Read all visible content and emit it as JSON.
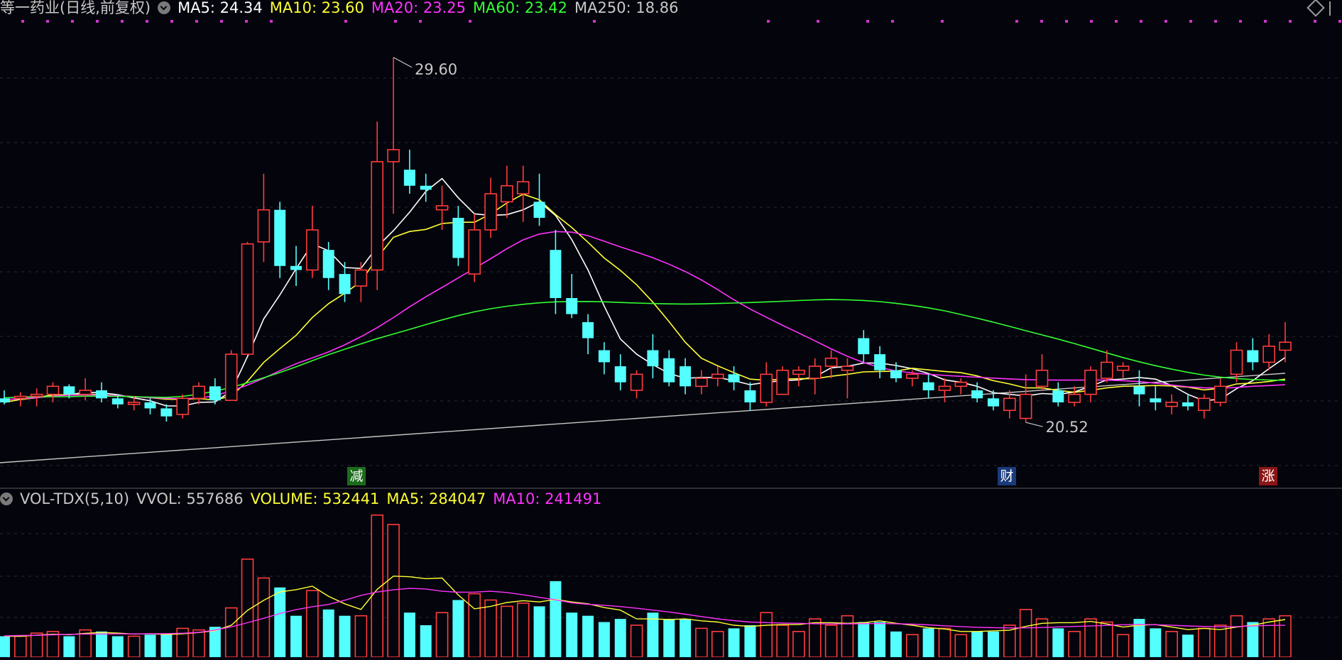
{
  "header": {
    "stock_title": "等一药业(日线,前复权)",
    "ma5": "MA5: 24.34",
    "ma10": "MA10: 23.60",
    "ma20": "MA20: 23.25",
    "ma60": "MA60: 23.42",
    "ma250": "MA250: 18.86"
  },
  "annotations": {
    "high_label": "29.60",
    "low_label": "20.52"
  },
  "event_badges": [
    {
      "label": "减",
      "color": "#1c6b1c"
    },
    {
      "label": "财",
      "color": "#1a3a7a"
    },
    {
      "label": "涨",
      "color": "#8a1515"
    }
  ],
  "volume_header": {
    "indicator": "VOL-TDX(5,10)",
    "vvol": "VVOL: 557686",
    "volume": "VOLUME: 532441",
    "ma5": "MA5: 284047",
    "ma10": "MA10: 241491"
  },
  "colors": {
    "up": "#ff3c3c",
    "down": "#54ffff",
    "ma5": "#ffffff",
    "ma10": "#ffff33",
    "ma20": "#ff33ff",
    "ma60": "#33ff33",
    "ma250": "#c8c8c8",
    "title": "#c8c8c8"
  },
  "chart_data": {
    "type": "candlestick",
    "price_range": [
      19.0,
      30.5
    ],
    "candles": [
      [
        21.1,
        21.3,
        20.95,
        21.0
      ],
      [
        21.1,
        21.25,
        20.9,
        21.15
      ],
      [
        21.15,
        21.35,
        20.9,
        21.2
      ],
      [
        21.2,
        21.5,
        21.0,
        21.4
      ],
      [
        21.4,
        21.45,
        21.1,
        21.2
      ],
      [
        21.2,
        21.6,
        21.05,
        21.3
      ],
      [
        21.3,
        21.5,
        21.0,
        21.1
      ],
      [
        21.1,
        21.2,
        20.85,
        20.95
      ],
      [
        20.95,
        21.15,
        20.8,
        21.0
      ],
      [
        21.0,
        21.1,
        20.7,
        20.85
      ],
      [
        20.85,
        20.95,
        20.52,
        20.65
      ],
      [
        20.7,
        21.2,
        20.6,
        21.1
      ],
      [
        21.1,
        21.5,
        20.95,
        21.4
      ],
      [
        21.4,
        21.6,
        20.95,
        21.05
      ],
      [
        21.05,
        22.3,
        21.05,
        22.2
      ],
      [
        22.2,
        25.0,
        22.2,
        24.95
      ],
      [
        25.0,
        26.7,
        24.5,
        25.8
      ],
      [
        25.8,
        26.0,
        24.1,
        24.4
      ],
      [
        24.4,
        24.9,
        23.9,
        24.3
      ],
      [
        24.3,
        25.9,
        24.1,
        25.3
      ],
      [
        24.8,
        25.0,
        23.8,
        24.1
      ],
      [
        24.2,
        24.5,
        23.5,
        23.7
      ],
      [
        23.9,
        24.5,
        23.5,
        24.3
      ],
      [
        24.3,
        28.0,
        23.8,
        27.0
      ],
      [
        27.0,
        29.6,
        25.7,
        27.3
      ],
      [
        26.8,
        27.3,
        26.2,
        26.4
      ],
      [
        26.4,
        26.7,
        26.0,
        26.3
      ],
      [
        25.8,
        26.4,
        25.3,
        25.9
      ],
      [
        25.6,
        25.9,
        24.4,
        24.6
      ],
      [
        24.2,
        25.7,
        24.0,
        25.3
      ],
      [
        25.3,
        26.6,
        25.1,
        26.2
      ],
      [
        26.0,
        26.9,
        25.6,
        26.4
      ],
      [
        26.2,
        26.9,
        25.5,
        26.5
      ],
      [
        26.0,
        26.7,
        25.4,
        25.6
      ],
      [
        24.8,
        25.3,
        23.2,
        23.6
      ],
      [
        23.6,
        24.2,
        23.1,
        23.2
      ],
      [
        23.0,
        23.2,
        22.2,
        22.6
      ],
      [
        22.3,
        22.5,
        21.7,
        22.0
      ],
      [
        21.9,
        22.2,
        21.3,
        21.5
      ],
      [
        21.3,
        21.8,
        21.1,
        21.7
      ],
      [
        22.3,
        22.7,
        21.6,
        21.9
      ],
      [
        22.1,
        22.3,
        21.4,
        21.5
      ],
      [
        21.9,
        22.1,
        21.2,
        21.4
      ],
      [
        21.4,
        21.8,
        21.2,
        21.6
      ],
      [
        21.6,
        21.9,
        21.4,
        21.7
      ],
      [
        21.7,
        21.9,
        21.3,
        21.5
      ],
      [
        21.3,
        21.5,
        20.8,
        21.0
      ],
      [
        21.0,
        22.0,
        20.9,
        21.7
      ],
      [
        21.2,
        21.9,
        21.2,
        21.8
      ],
      [
        21.7,
        21.9,
        21.4,
        21.8
      ],
      [
        21.6,
        22.1,
        21.2,
        21.9
      ],
      [
        21.9,
        22.3,
        21.6,
        22.1
      ],
      [
        21.8,
        22.1,
        21.1,
        21.9
      ],
      [
        22.6,
        22.8,
        22.0,
        22.2
      ],
      [
        22.2,
        22.4,
        21.6,
        21.8
      ],
      [
        21.8,
        22.0,
        21.5,
        21.6
      ],
      [
        21.6,
        21.8,
        21.4,
        21.7
      ],
      [
        21.5,
        21.7,
        21.1,
        21.3
      ],
      [
        21.3,
        21.6,
        21.0,
        21.4
      ],
      [
        21.4,
        21.6,
        21.2,
        21.5
      ],
      [
        21.3,
        21.5,
        21.0,
        21.1
      ],
      [
        21.1,
        21.3,
        20.8,
        20.9
      ],
      [
        20.8,
        21.3,
        20.6,
        21.1
      ],
      [
        20.6,
        21.7,
        20.5,
        21.2
      ],
      [
        21.4,
        22.2,
        21.3,
        21.8
      ],
      [
        21.3,
        21.5,
        20.9,
        21.0
      ],
      [
        21.0,
        21.4,
        20.9,
        21.2
      ],
      [
        21.2,
        21.9,
        21.0,
        21.8
      ],
      [
        21.6,
        22.3,
        21.5,
        22.0
      ],
      [
        21.8,
        22.0,
        21.6,
        21.9
      ],
      [
        21.4,
        21.8,
        20.9,
        21.2
      ],
      [
        21.1,
        21.4,
        20.8,
        21.0
      ],
      [
        20.9,
        21.2,
        20.7,
        21.0
      ],
      [
        21.0,
        21.2,
        20.8,
        20.9
      ],
      [
        20.8,
        21.2,
        20.6,
        21.1
      ],
      [
        21.0,
        21.6,
        20.9,
        21.4
      ],
      [
        21.7,
        22.5,
        21.5,
        22.3
      ],
      [
        22.3,
        22.6,
        21.8,
        22.0
      ],
      [
        22.0,
        22.7,
        21.8,
        22.4
      ],
      [
        22.3,
        23.0,
        22.0,
        22.5
      ]
    ]
  }
}
